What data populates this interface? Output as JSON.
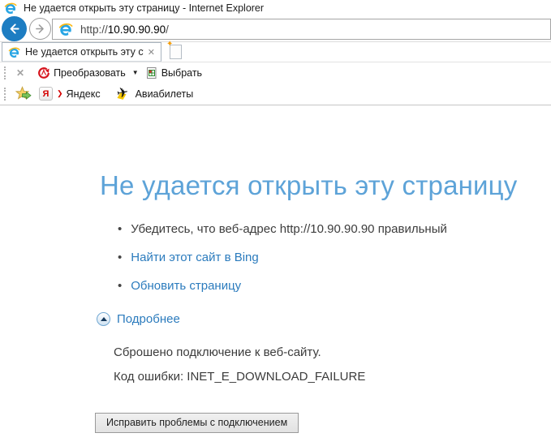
{
  "window_title": "Не удается открыть эту страницу - Internet Explorer",
  "navigation": {
    "url_prefix": "http://",
    "url_host": "10.90.90.90",
    "url_path": "/"
  },
  "tab_bar": {
    "active_tab_label": "Не удается открыть эту ст..."
  },
  "command_bar": {
    "convert_label": "Преобразовать",
    "select_label": "Выбрать"
  },
  "favorites_bar": {
    "yandex_label": "Яндекс",
    "yandex_letter": "Я",
    "avia_label": "Авиабилеты"
  },
  "error_page": {
    "heading": "Не удается открыть эту страницу",
    "bullets": [
      "Убедитесь, что веб-адрес http://10.90.90.90 правильный",
      "Найти этот сайт в Bing",
      "Обновить страницу"
    ],
    "details_toggle_label": "Подробнее",
    "detail_message": "Сброшено подключение к веб-сайту.",
    "error_code_line": "Код ошибки: INET_E_DOWNLOAD_FAILURE",
    "fix_button_label": "Исправить проблемы с подключением"
  },
  "icons": {
    "tab_close": "✕",
    "toolbar_close": "✕",
    "dropdown": "▼",
    "new_tab_sparkle": "✦",
    "plane": "✈",
    "yandex_chevron": "❯",
    "bullet": "•"
  },
  "colors": {
    "back_button_blue": "#1d7dc2",
    "heading_blue": "#5da3d8",
    "link_blue": "#2b7bbd",
    "body_text": "#3c3c3c",
    "ie_logo_blue": "#27a5e4",
    "ie_logo_swoosh": "#fdb913"
  }
}
